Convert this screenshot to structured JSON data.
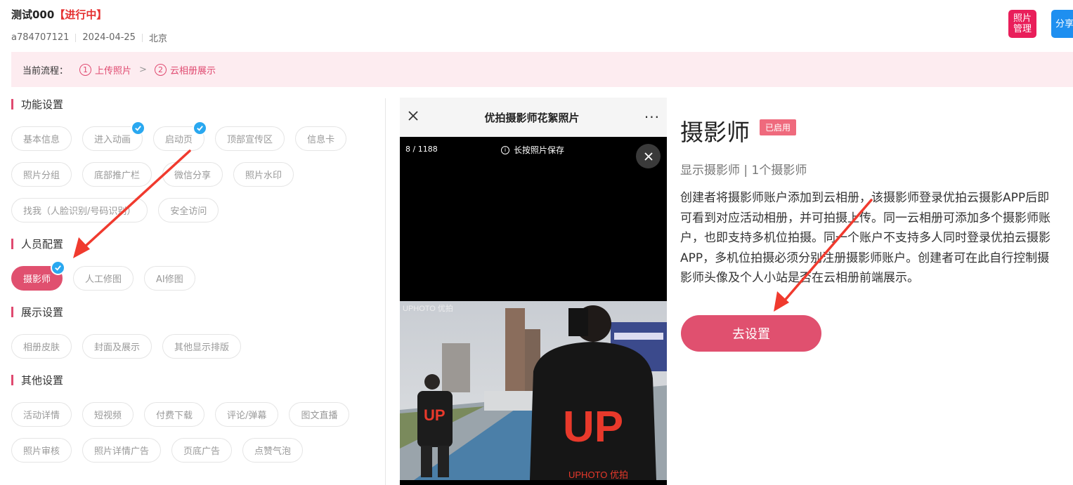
{
  "header": {
    "event_name": "测试000",
    "event_status": "【进行中】",
    "account": "a784707121",
    "date": "2024-04-25",
    "city": "北京",
    "photo_manage_label": "照片管理",
    "share_label": "分享"
  },
  "flow": {
    "label": "当前流程：",
    "steps": [
      {
        "num": "1",
        "label": "上传照片"
      },
      {
        "num": "2",
        "label": "云相册展示"
      }
    ],
    "arrow": ">"
  },
  "sections": {
    "function": {
      "title": "功能设置",
      "items": [
        "基本信息",
        "进入动画",
        "启动页",
        "顶部宣传区",
        "信息卡",
        "照片分组",
        "底部推广栏",
        "微信分享",
        "照片水印",
        "找我（人脸识别/号码识别）",
        "安全访问"
      ]
    },
    "staff": {
      "title": "人员配置",
      "items": [
        "摄影师",
        "人工修图",
        "AI修图"
      ]
    },
    "display": {
      "title": "展示设置",
      "items": [
        "相册皮肤",
        "封面及展示",
        "其他显示排版"
      ]
    },
    "other": {
      "title": "其他设置",
      "items": [
        "活动详情",
        "短视频",
        "付费下载",
        "评论/弹幕",
        "图文直播",
        "照片审核",
        "照片详情广告",
        "页底广告",
        "点赞气泡"
      ]
    }
  },
  "preview": {
    "title": "优拍摄影师花絮照片",
    "counter": "8 / 1188",
    "save_tip": "长按照片保存",
    "watermark": "UPHOTO 优拍"
  },
  "detail": {
    "title": "摄影师",
    "badge": "已启用",
    "subtitle": "显示摄影师 | 1个摄影师",
    "description": "创建者将摄影师账户添加到云相册，该摄影师登录优拍云摄影APP后即可看到对应活动相册，并可拍摄上传。同一云相册可添加多个摄影师账户，也即支持多机位拍摄。同一个账户不支持多人同时登录优拍云摄影APP，多机位拍摄必须分别注册摄影师账户。创建者可在此自行控制摄影师头像及个人小站是否在云相册前端展示。",
    "button_label": "去设置"
  },
  "colors": {
    "accent": "#e0506f",
    "status_red": "#e52f2f",
    "check_blue": "#2aa8f0",
    "photo_manage": "#e91e5a",
    "share": "#1e8ff0",
    "annotation_arrow": "#f03a2e"
  }
}
